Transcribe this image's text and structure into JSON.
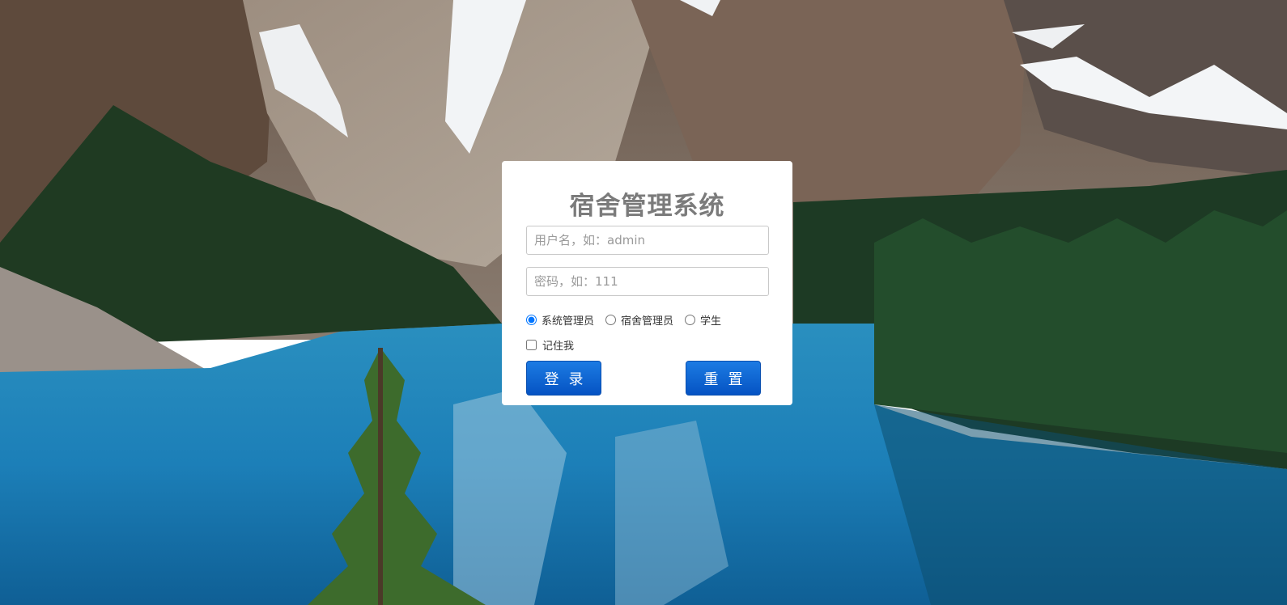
{
  "login": {
    "title": "宿舍管理系统",
    "username_placeholder": "用户名，如：admin",
    "password_placeholder": "密码，如：111",
    "roles": [
      {
        "label": "系统管理员",
        "checked": true
      },
      {
        "label": "宿舍管理员",
        "checked": false
      },
      {
        "label": "学生",
        "checked": false
      }
    ],
    "remember_label": "记住我",
    "login_button": "登录",
    "reset_button": "重置"
  },
  "colors": {
    "button_primary": "#0a62d6",
    "title_text": "#7b7b7b",
    "card_background": "#ffffff"
  }
}
